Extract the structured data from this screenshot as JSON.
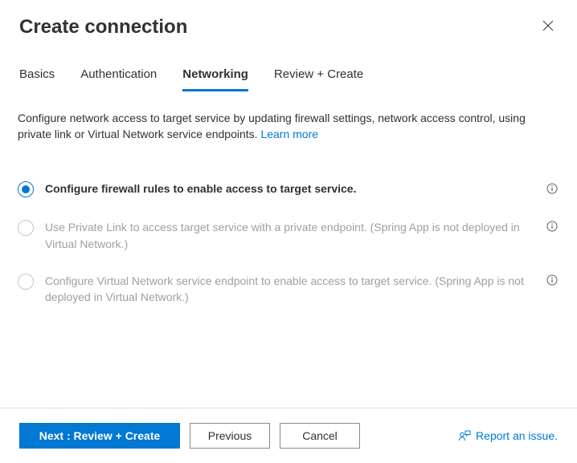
{
  "header": {
    "title": "Create connection"
  },
  "tabs": [
    {
      "label": "Basics",
      "active": false
    },
    {
      "label": "Authentication",
      "active": false
    },
    {
      "label": "Networking",
      "active": true
    },
    {
      "label": "Review + Create",
      "active": false
    }
  ],
  "description": {
    "text": "Configure network access to target service by updating firewall settings, network access control, using private link or Virtual Network service endpoints.",
    "learn_more": "Learn more"
  },
  "options": [
    {
      "label": "Configure firewall rules to enable access to target service.",
      "selected": true,
      "disabled": false,
      "info_inline": true
    },
    {
      "label": "Use Private Link to access target service with a private endpoint. (Spring App is not deployed in Virtual Network.)",
      "selected": false,
      "disabled": true,
      "info_inline": false
    },
    {
      "label": "Configure Virtual Network service endpoint to enable access to target service. (Spring App is not deployed in Virtual Network.)",
      "selected": false,
      "disabled": true,
      "info_inline": false
    }
  ],
  "footer": {
    "primary": "Next : Review + Create",
    "previous": "Previous",
    "cancel": "Cancel",
    "report": "Report an issue."
  }
}
